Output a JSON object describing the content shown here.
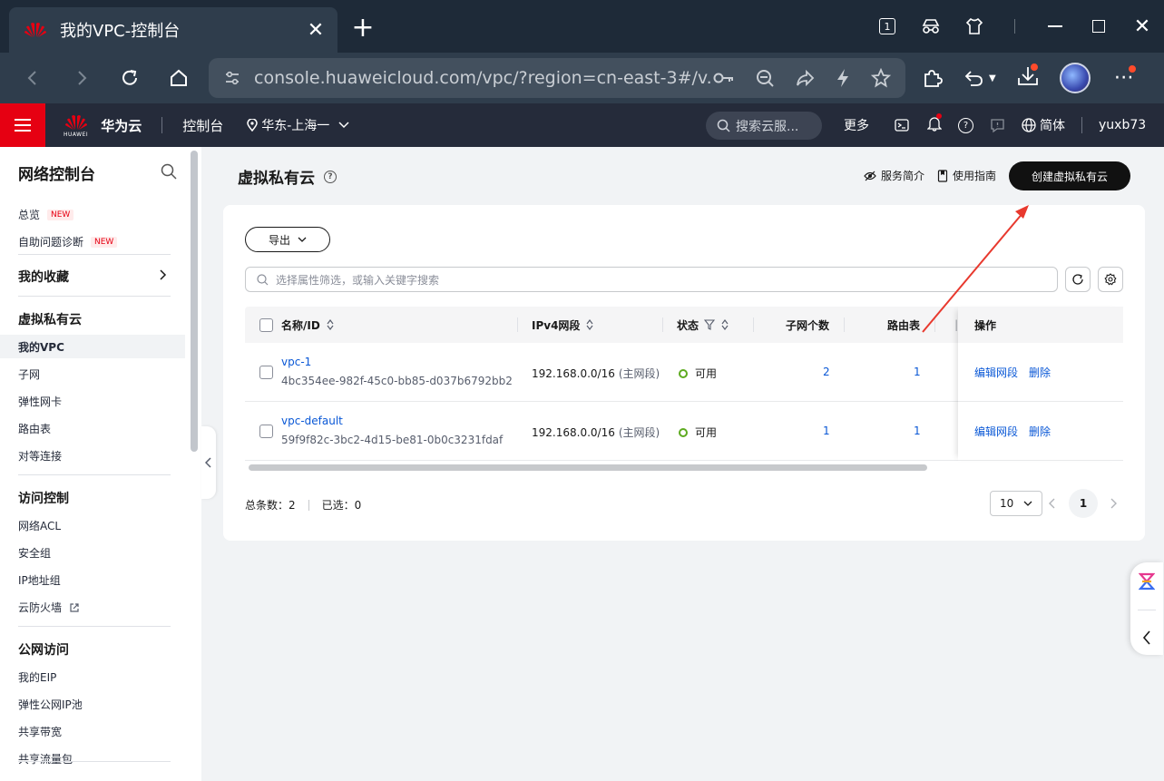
{
  "browser": {
    "tab_title": "我的VPC-控制台",
    "tab_count": "1",
    "url": "console.huaweicloud.com/vpc/?region=cn-east-3#/v..."
  },
  "header": {
    "brand": "华为云",
    "brand_logo_text": "HUAWEI",
    "console": "控制台",
    "region": "华东-上海一",
    "search_placeholder": "搜索云服...",
    "more": "更多",
    "language": "简体",
    "user": "yuxb73"
  },
  "sidebar": {
    "title": "网络控制台",
    "new_badge": "NEW",
    "items_top": [
      {
        "label": "总览"
      },
      {
        "label": "自助问题诊断"
      }
    ],
    "favorites": "我的收藏",
    "groups": [
      {
        "title": "虚拟私有云",
        "items": [
          "我的VPC",
          "子网",
          "弹性网卡",
          "路由表",
          "对等连接"
        ]
      },
      {
        "title": "访问控制",
        "items": [
          "网络ACL",
          "安全组",
          "IP地址组",
          "云防火墙"
        ]
      },
      {
        "title": "公网访问",
        "items": [
          "我的EIP",
          "弹性公网IP池",
          "共享带宽",
          "共享流量包"
        ]
      }
    ]
  },
  "page": {
    "title": "虚拟私有云",
    "service_intro": "服务简介",
    "user_guide": "使用指南",
    "create_button": "创建虚拟私有云",
    "export_button": "导出",
    "filter_placeholder": "选择属性筛选，或输入关键字搜索"
  },
  "table": {
    "columns": [
      "名称/ID",
      "IPv4网段",
      "状态",
      "子网个数",
      "路由表",
      "操作"
    ],
    "rows": [
      {
        "name": "vpc-1",
        "id": "4bc354ee-982f-45c0-bb85-d037b6792bb2",
        "ipv4": "192.168.0.0/16",
        "ipv4_note": "(主网段)",
        "status": "可用",
        "subnets": "2",
        "route_tables": "1",
        "op_edit": "编辑网段",
        "op_delete": "删除"
      },
      {
        "name": "vpc-default",
        "id": "59f9f82c-3bc2-4d15-be81-0b0c3231fdaf",
        "ipv4": "192.168.0.0/16",
        "ipv4_note": "(主网段)",
        "status": "可用",
        "subnets": "1",
        "route_tables": "1",
        "op_edit": "编辑网段",
        "op_delete": "删除"
      }
    ]
  },
  "footer": {
    "total": "总条数：2",
    "selected": "已选：0",
    "page_size": "10",
    "current_page": "1"
  },
  "colors": {
    "brand_red": "#e60012",
    "link_blue": "#0a58d6",
    "status_green": "#5daa1f",
    "annotation_red": "#e8392e"
  }
}
